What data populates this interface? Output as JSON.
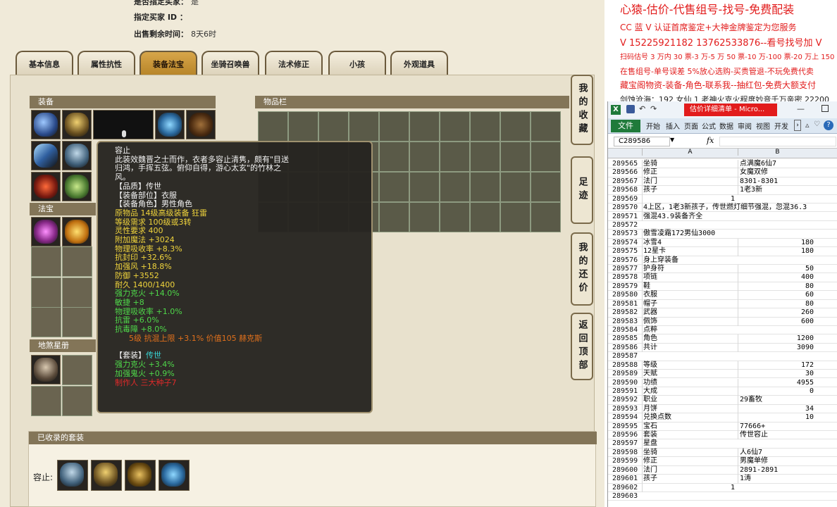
{
  "game": {
    "seller_line": "是否指定买家：",
    "seller_value": "是",
    "buyer_id_label": "指定买家 ID ：",
    "time_label": "出售剩余时间：",
    "time_value": "8天6时",
    "tabs": [
      {
        "label": "基本信息",
        "active": false
      },
      {
        "label": "属性抗性",
        "active": false
      },
      {
        "label": "装备法宝",
        "active": true
      },
      {
        "label": "坐骑召唤兽",
        "active": false
      },
      {
        "label": "法术修正",
        "active": false
      },
      {
        "label": "小孩",
        "active": false
      },
      {
        "label": "外观道具",
        "active": false
      }
    ],
    "panels": {
      "equipment": "装备",
      "treasure": "法宝",
      "earth_star": "地煞星册",
      "inventory": "物品栏",
      "collected_suits": "已收录的套装"
    },
    "suit_label": "容止:",
    "side_buttons": [
      "我的收藏",
      "足迹",
      "我的还价",
      "返回顶部"
    ],
    "tooltip": {
      "title": "容止",
      "desc_lines": [
        "此装效魏晋之士而作，衣者多容止清隽，颇有\"目送",
        "归鸿，手挥五弦。俯仰自得，游心太玄\"的竹林之",
        "风。"
      ],
      "quality": "【品质】传世",
      "part": "【装备部位】衣服",
      "role": "【装备角色】男性角色",
      "origin": "原物品 14级高级装备 狂雷",
      "req_level": "等级需求 100级或3转",
      "spirit": "灵性要求 400",
      "magic": "附加魔法 +3024",
      "phys_absorb": "物理吸收率 +8.3%",
      "seal": "抗封印 +32.6%",
      "wind": "加强风 +18.8%",
      "defense": "防御 +3552",
      "durability": "耐久 1400/1400",
      "fire": "强力克火 +14.0%",
      "agility": "敏捷 +8",
      "phys_absorb2": "物理吸收率 +1.0%",
      "thunder": "抗雷 +6.0%",
      "poison": "抗毒障 +8.0%",
      "refine": "5级 抗混上限 +3.1% 价值105 赫克斯",
      "suit_head": "【套装】",
      "suit_value": "传世",
      "suit_fire": "强力克火 +3.4%",
      "suit_ghost": "加强鬼火 +0.9%",
      "maker": "制作人 三大种子7"
    },
    "colors": {
      "tab_active": "#c9973a",
      "panel_head": "#837558",
      "tooltip_bg": "#262420"
    }
  },
  "right_panel": {
    "lines": [
      {
        "text": "心猿-估价-代售组号-找号-免费配装",
        "size": "big"
      },
      {
        "text": "CC 蓝 V 认证首席鉴定+大神金牌鉴定为您服务",
        "size": "normal"
      },
      {
        "text": "V 15225921182    13762533876--看号找号加 V",
        "size": "mid"
      },
      {
        "text": "扫码估号 3 万内 30 票-3 万-5 万 50 票-10 万-100 票-20 万上 150",
        "size": "small"
      },
      {
        "text": "在售组号-单号误差 5%放心选购-买贵管退-不玩免费代卖",
        "size": "small"
      },
      {
        "text": "藏宝阁物资-装备-角色-联系我--抽红包-免费大额支付",
        "size": "normal"
      },
      {
        "text": "剑蚀沧海：192 女仙 1 老神火克火程度妙音千万亲密 22200",
        "size": "small",
        "dark": true
      }
    ]
  },
  "excel": {
    "title_tab": "估价详细清单 - Micro...",
    "ribbon_tabs": [
      "文件",
      "开始",
      "插入",
      "页面",
      "公式",
      "数据",
      "审阅",
      "视图",
      "开发"
    ],
    "name_box": "C289586",
    "fx": "fx",
    "col_a": "A",
    "col_b": "B",
    "rows": [
      {
        "n": "289565",
        "a": "坐骑",
        "b": "点满魔6仙7"
      },
      {
        "n": "289566",
        "a": "修正",
        "b": "女魔双修"
      },
      {
        "n": "289567",
        "a": "法门",
        "b": "8301-8301"
      },
      {
        "n": "289568",
        "a": "孩子",
        "b": "1老3新"
      },
      {
        "n": "289569",
        "a": "1",
        "b": "",
        "an": true
      },
      {
        "n": "289570",
        "a": "4上区，1老3新孩子，传世燃灯细节强混，忽混36.3",
        "b": ""
      },
      {
        "n": "289571",
        "a": "强混43.9装备齐全",
        "b": ""
      },
      {
        "n": "289572",
        "a": "",
        "b": ""
      },
      {
        "n": "289573",
        "a": "傲雪凌霜172男仙3000",
        "b": ""
      },
      {
        "n": "289574",
        "a": "冰雪4",
        "b": "180",
        "bn": true
      },
      {
        "n": "289575",
        "a": "12星卡",
        "b": "180",
        "bn": true
      },
      {
        "n": "289576",
        "a": "身上穿装备",
        "b": ""
      },
      {
        "n": "289577",
        "a": "护身符",
        "b": "50",
        "bn": true
      },
      {
        "n": "289578",
        "a": "项链",
        "b": "400",
        "bn": true
      },
      {
        "n": "289579",
        "a": "鞋",
        "b": "80",
        "bn": true
      },
      {
        "n": "289580",
        "a": "衣服",
        "b": "60",
        "bn": true
      },
      {
        "n": "289581",
        "a": "帽子",
        "b": "80",
        "bn": true
      },
      {
        "n": "289582",
        "a": "武器",
        "b": "260",
        "bn": true
      },
      {
        "n": "289583",
        "a": "佩饰",
        "b": "600",
        "bn": true
      },
      {
        "n": "289584",
        "a": "点粹",
        "b": ""
      },
      {
        "n": "289585",
        "a": "角色",
        "b": "1200",
        "bn": true
      },
      {
        "n": "289586",
        "a": "共计",
        "b": "3090",
        "bn": true
      },
      {
        "n": "289587",
        "a": "",
        "b": ""
      },
      {
        "n": "289588",
        "a": "等级",
        "b": "172",
        "bn": true
      },
      {
        "n": "289589",
        "a": "天赋",
        "b": "30",
        "bn": true
      },
      {
        "n": "289590",
        "a": "功绩",
        "b": "4955",
        "bn": true
      },
      {
        "n": "289591",
        "a": "大成",
        "b": "0",
        "bn": true
      },
      {
        "n": "289592",
        "a": "职业",
        "b": "29畜牧"
      },
      {
        "n": "289593",
        "a": "月饼",
        "b": "34",
        "bn": true
      },
      {
        "n": "289594",
        "a": "兑换点数",
        "b": "10",
        "bn": true
      },
      {
        "n": "289595",
        "a": "宝石",
        "b": "77666+"
      },
      {
        "n": "289596",
        "a": "套装",
        "b": "传世容止"
      },
      {
        "n": "289597",
        "a": "星盘",
        "b": ""
      },
      {
        "n": "289598",
        "a": "坐骑",
        "b": "人6仙7"
      },
      {
        "n": "289599",
        "a": "修正",
        "b": "男魔单修"
      },
      {
        "n": "289600",
        "a": "法门",
        "b": "2891-2891"
      },
      {
        "n": "289601",
        "a": "孩子",
        "b": "1涛"
      },
      {
        "n": "289602",
        "a": "1",
        "b": "",
        "an": true
      },
      {
        "n": "289603",
        "a": "",
        "b": ""
      }
    ]
  }
}
